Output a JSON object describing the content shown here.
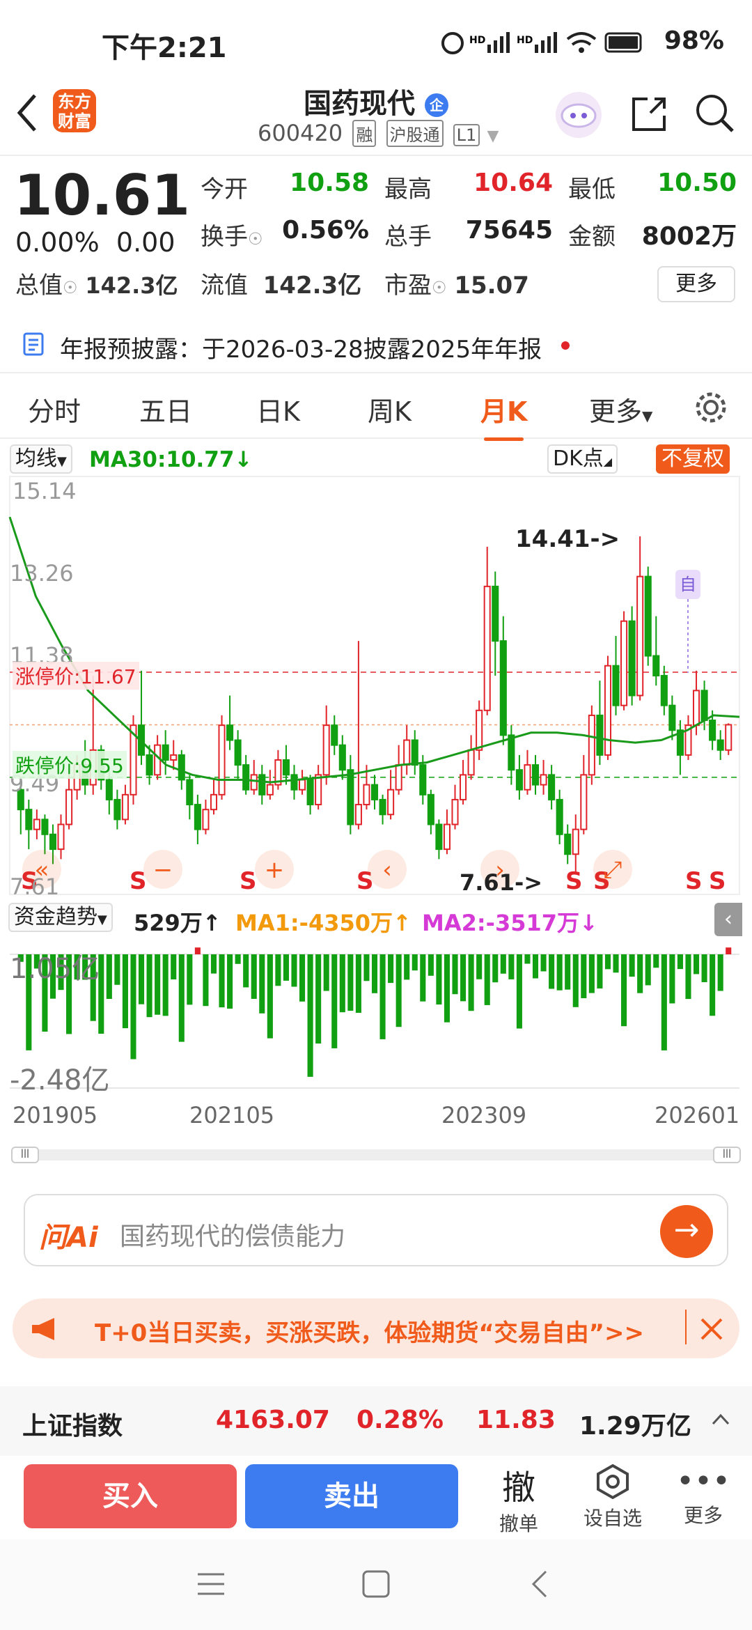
{
  "status": {
    "time": "下午2:21",
    "battery": "98%"
  },
  "header": {
    "logo": "东方\n财富",
    "title": "国药现代",
    "badge": "企",
    "code": "600420",
    "tags": [
      "融",
      "沪股通",
      "L1"
    ]
  },
  "quote": {
    "price": "10.61",
    "change_pct": "0.00%",
    "change": "0.00",
    "fields": [
      {
        "label": "今开",
        "value": "10.58",
        "color": "green"
      },
      {
        "label": "最高",
        "value": "10.64",
        "color": "red"
      },
      {
        "label": "最低",
        "value": "10.50",
        "color": "green"
      },
      {
        "label": "换手",
        "value": "0.56%",
        "color": ""
      },
      {
        "label": "总手",
        "value": "75645",
        "color": ""
      },
      {
        "label": "金额",
        "value": "8002万",
        "color": ""
      }
    ],
    "zongzhi_label": "总值",
    "zongzhi": "142.3亿",
    "liuzhi_label": "流值",
    "liuzhi": "142.3亿",
    "shiying_label": "市盈",
    "shiying": "15.07",
    "more": "更多"
  },
  "notice": "年报预披露：于2026-03-28披露2025年年报",
  "tabs": [
    "分时",
    "五日",
    "日K",
    "周K",
    "月K",
    "更多"
  ],
  "chart_controls": {
    "ma_select": "均线",
    "ma30": "MA30:10.77↓",
    "dk": "DK点",
    "fuquan": "不复权",
    "limit_up": "涨停价:11.67",
    "limit_down": "跌停价:9.55",
    "high_marker": "14.41->",
    "low_marker": "7.61->",
    "self_marker": "自"
  },
  "chart_data": {
    "type": "candlestick",
    "title": "",
    "y_ticks": [
      "15.14",
      "13.26",
      "11.38",
      "9.49",
      "7.61"
    ],
    "x_ticks": [
      "201905",
      "202105",
      "202309",
      "202601"
    ],
    "ylim": [
      7.61,
      15.14
    ],
    "candles": [
      [
        9.3,
        8.9,
        9.5,
        8.4
      ],
      [
        8.9,
        8.5,
        9.1,
        8.1
      ],
      [
        8.5,
        8.7,
        8.9,
        8.3
      ],
      [
        8.7,
        8.4,
        8.8,
        8.0
      ],
      [
        8.4,
        8.1,
        8.6,
        7.8
      ],
      [
        8.1,
        8.6,
        8.8,
        7.9
      ],
      [
        8.6,
        9.3,
        9.6,
        8.5
      ],
      [
        9.3,
        9.8,
        10.0,
        9.1
      ],
      [
        9.8,
        9.4,
        10.3,
        9.2
      ],
      [
        9.4,
        10.1,
        11.6,
        9.2
      ],
      [
        10.1,
        9.5,
        10.2,
        9.3
      ],
      [
        9.5,
        9.1,
        9.7,
        8.8
      ],
      [
        9.1,
        8.7,
        9.3,
        8.5
      ],
      [
        8.7,
        9.2,
        9.4,
        8.6
      ],
      [
        9.2,
        10.6,
        10.8,
        9.0
      ],
      [
        10.6,
        10.0,
        11.7,
        9.8
      ],
      [
        10.0,
        9.6,
        10.2,
        9.4
      ],
      [
        9.6,
        10.2,
        10.4,
        9.5
      ],
      [
        10.2,
        9.9,
        10.5,
        9.6
      ],
      [
        9.9,
        10.0,
        10.3,
        9.7
      ],
      [
        10.0,
        9.5,
        10.1,
        9.3
      ],
      [
        9.5,
        9.0,
        9.6,
        8.7
      ],
      [
        9.0,
        8.5,
        9.2,
        8.2
      ],
      [
        8.5,
        8.9,
        9.1,
        8.4
      ],
      [
        8.9,
        9.2,
        9.5,
        8.8
      ],
      [
        9.2,
        10.6,
        10.8,
        9.1
      ],
      [
        10.6,
        10.3,
        11.2,
        10.1
      ],
      [
        10.3,
        9.8,
        10.5,
        9.5
      ],
      [
        9.8,
        9.3,
        10.0,
        9.2
      ],
      [
        9.3,
        9.6,
        9.9,
        9.2
      ],
      [
        9.6,
        9.2,
        9.8,
        9.0
      ],
      [
        9.2,
        9.4,
        9.7,
        9.1
      ],
      [
        9.4,
        9.9,
        10.1,
        9.3
      ],
      [
        9.9,
        9.6,
        10.2,
        9.4
      ],
      [
        9.6,
        9.3,
        9.8,
        9.1
      ],
      [
        9.3,
        9.5,
        9.7,
        9.2
      ],
      [
        9.5,
        9.0,
        9.6,
        8.8
      ],
      [
        9.0,
        9.6,
        9.8,
        8.9
      ],
      [
        9.6,
        10.6,
        11.0,
        9.4
      ],
      [
        10.6,
        10.2,
        10.8,
        10.0
      ],
      [
        10.2,
        9.7,
        10.4,
        9.5
      ],
      [
        9.7,
        8.6,
        10.0,
        8.4
      ],
      [
        8.6,
        9.0,
        12.3,
        8.5
      ],
      [
        9.0,
        9.4,
        9.8,
        8.9
      ],
      [
        9.4,
        9.1,
        9.6,
        8.9
      ],
      [
        9.1,
        8.8,
        9.2,
        8.6
      ],
      [
        8.8,
        9.3,
        9.7,
        8.7
      ],
      [
        9.3,
        9.8,
        10.2,
        9.2
      ],
      [
        9.8,
        10.3,
        10.6,
        9.6
      ],
      [
        10.3,
        9.8,
        10.5,
        9.6
      ],
      [
        9.8,
        9.2,
        10.0,
        9.0
      ],
      [
        9.2,
        8.6,
        9.3,
        8.4
      ],
      [
        8.6,
        8.1,
        8.7,
        7.9
      ],
      [
        8.1,
        8.6,
        8.9,
        8.0
      ],
      [
        8.6,
        9.1,
        9.4,
        8.5
      ],
      [
        9.1,
        9.6,
        9.9,
        9.0
      ],
      [
        9.6,
        10.1,
        10.4,
        9.5
      ],
      [
        10.1,
        10.9,
        11.1,
        9.9
      ],
      [
        10.9,
        13.4,
        14.2,
        10.8
      ],
      [
        13.4,
        12.3,
        13.7,
        11.6
      ],
      [
        12.3,
        10.4,
        12.8,
        10.2
      ],
      [
        10.4,
        9.7,
        10.6,
        9.4
      ],
      [
        9.7,
        9.3,
        10.0,
        9.1
      ],
      [
        9.3,
        9.8,
        10.1,
        9.2
      ],
      [
        9.8,
        9.4,
        10.0,
        9.2
      ],
      [
        9.4,
        9.6,
        9.9,
        9.2
      ],
      [
        9.6,
        9.1,
        9.8,
        8.9
      ],
      [
        9.1,
        8.4,
        9.3,
        8.2
      ],
      [
        8.4,
        8.0,
        8.6,
        7.8
      ],
      [
        8.0,
        8.5,
        8.8,
        7.61
      ],
      [
        8.5,
        9.6,
        10.0,
        8.4
      ],
      [
        9.6,
        10.8,
        11.0,
        9.4
      ],
      [
        10.8,
        10.0,
        11.5,
        9.8
      ],
      [
        10.0,
        11.8,
        12.0,
        9.9
      ],
      [
        11.8,
        11.0,
        12.4,
        10.8
      ],
      [
        11.0,
        12.7,
        12.9,
        10.9
      ],
      [
        12.7,
        11.2,
        13.0,
        11.0
      ],
      [
        11.2,
        13.6,
        14.41,
        11.1
      ],
      [
        13.6,
        12.0,
        13.8,
        11.8
      ],
      [
        12.0,
        11.6,
        12.8,
        11.4
      ],
      [
        11.6,
        11.0,
        11.8,
        10.8
      ],
      [
        11.0,
        10.5,
        11.2,
        10.3
      ],
      [
        10.5,
        10.0,
        10.7,
        9.6
      ],
      [
        10.0,
        10.6,
        10.8,
        9.9
      ],
      [
        10.6,
        11.3,
        11.7,
        10.4
      ],
      [
        11.3,
        10.7,
        11.5,
        10.5
      ],
      [
        10.7,
        10.3,
        10.9,
        10.1
      ],
      [
        10.3,
        10.1,
        10.5,
        9.9
      ],
      [
        10.1,
        10.61,
        10.64,
        10.0
      ]
    ],
    "ma30": [
      14.8,
      13.2,
      12.2,
      11.3,
      10.8,
      10.3,
      9.8,
      9.6,
      9.5,
      9.5,
      9.45,
      9.5,
      9.55,
      9.6,
      9.7,
      9.8,
      9.85,
      10.0,
      10.15,
      10.3,
      10.45,
      10.45,
      10.4,
      10.3,
      10.25,
      10.3,
      10.5,
      10.8,
      10.77
    ],
    "fund_flow": {
      "title": "资金趋势",
      "current": "529万↑",
      "ma1": "MA1:-4350万↑",
      "ma2": "MA2:-3517万↓",
      "ymax": "1.05亿",
      "ymin": "-2.48亿"
    }
  },
  "ai": {
    "label": "问Ai",
    "placeholder": "国药现代的偿债能力"
  },
  "banner": {
    "text": "T+0当日买卖，买涨买跌，体验期货“交易自由”>>"
  },
  "index": {
    "name": "上证指数",
    "value": "4163.07",
    "pct": "0.28%",
    "chg": "11.83",
    "vol": "1.29万亿"
  },
  "bottom": {
    "buy": "买入",
    "sell": "卖出",
    "cancel_icon": "撤",
    "cancel": "撤单",
    "watch": "设自选",
    "more": "更多"
  },
  "colors": {
    "accent": "#f05a1a",
    "red": "#e0242a",
    "green": "#11a011",
    "blue": "#3d7cf0"
  }
}
